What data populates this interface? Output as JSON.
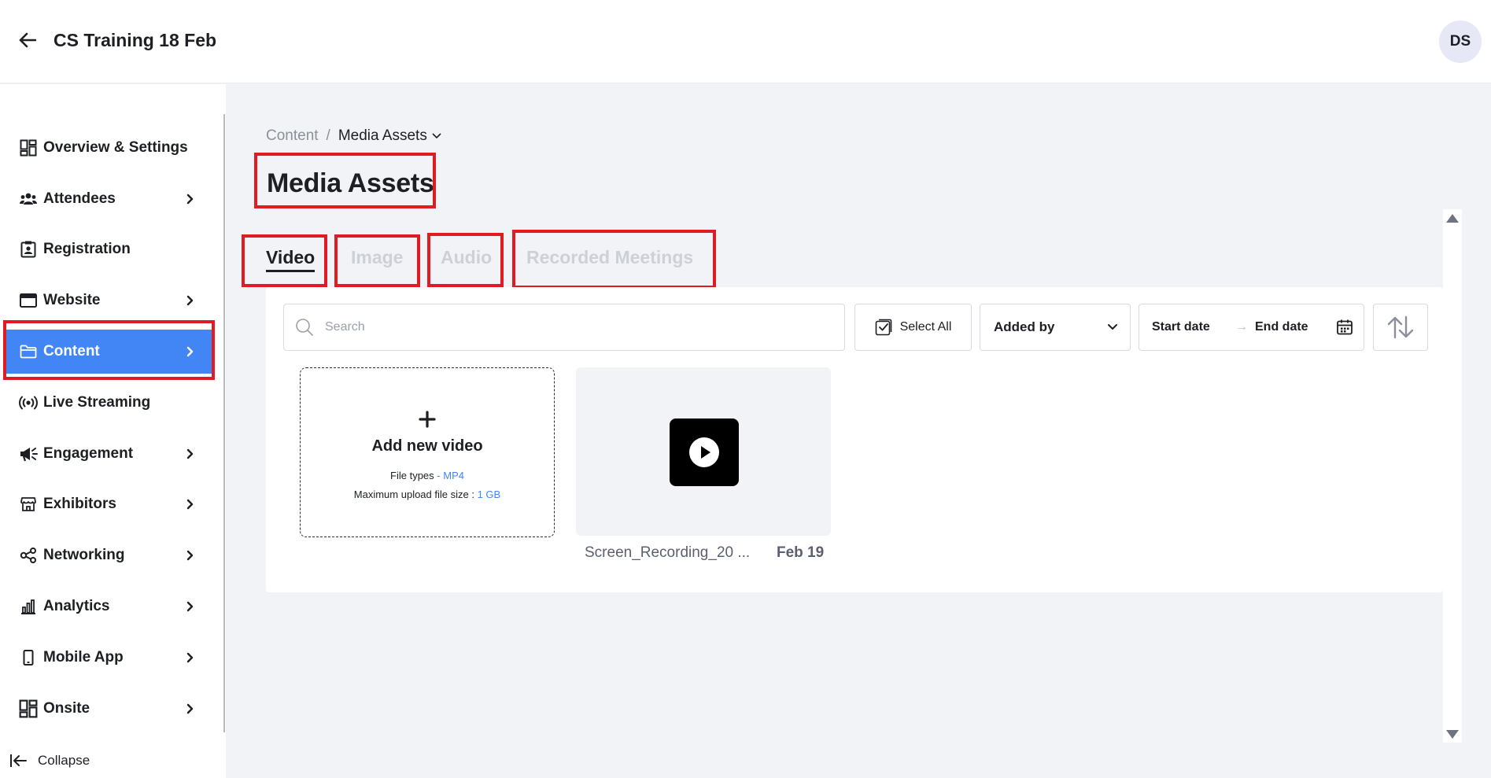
{
  "header": {
    "event_title": "CS Training 18 Feb",
    "avatar_initials": "DS"
  },
  "sidebar": {
    "items": [
      {
        "label": "Overview & Settings",
        "icon": "dashboard-icon",
        "has_chevron": false
      },
      {
        "label": "Attendees",
        "icon": "people-icon",
        "has_chevron": true
      },
      {
        "label": "Registration",
        "icon": "registration-icon",
        "has_chevron": false
      },
      {
        "label": "Website",
        "icon": "browser-window-icon",
        "has_chevron": true
      },
      {
        "label": "Content",
        "icon": "folder-icon",
        "has_chevron": true,
        "active": true
      },
      {
        "label": "Live Streaming",
        "icon": "broadcast-icon",
        "has_chevron": false
      },
      {
        "label": "Engagement",
        "icon": "megaphone-icon",
        "has_chevron": true
      },
      {
        "label": "Exhibitors",
        "icon": "storefront-icon",
        "has_chevron": true
      },
      {
        "label": "Networking",
        "icon": "share-nodes-icon",
        "has_chevron": true
      },
      {
        "label": "Analytics",
        "icon": "bar-chart-icon",
        "has_chevron": true
      },
      {
        "label": "Mobile App",
        "icon": "mobile-phone-icon",
        "has_chevron": true
      },
      {
        "label": "Onsite",
        "icon": "dashboard-icon",
        "has_chevron": true
      }
    ],
    "collapse_label": "Collapse"
  },
  "breadcrumb": {
    "root": "Content",
    "separator": "/",
    "current": "Media Assets"
  },
  "page_title": "Media Assets",
  "tabs": [
    {
      "label": "Video",
      "active": true
    },
    {
      "label": "Image",
      "active": false
    },
    {
      "label": "Audio",
      "active": false
    },
    {
      "label": "Recorded Meetings",
      "active": false
    }
  ],
  "toolbar": {
    "search_placeholder": "Search",
    "select_all_label": "Select All",
    "added_by_label": "Added by",
    "start_date_label": "Start date",
    "date_arrow": "→",
    "end_date_label": "End date"
  },
  "add_card": {
    "label": "Add new video",
    "file_types_label": "File types",
    "file_types_value": "- MP4",
    "max_size_label": "Maximum upload file size :",
    "max_size_value": "1 GB"
  },
  "videos": [
    {
      "name": "Screen_Recording_20 ...",
      "date": "Feb 19"
    }
  ],
  "colors": {
    "accent": "#4285f4",
    "highlight_outline": "#e01b22",
    "inactive_tab": "#cdd0d6"
  }
}
